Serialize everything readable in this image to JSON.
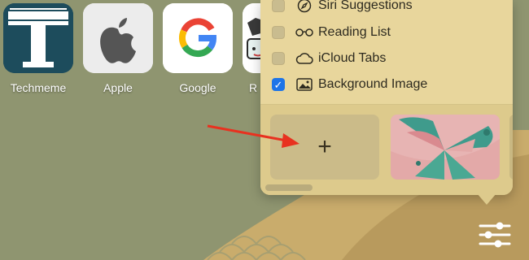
{
  "favorites": [
    {
      "label": "Techmeme",
      "icon": "techmeme-T-logo"
    },
    {
      "label": "Apple",
      "icon": "apple-logo"
    },
    {
      "label": "Google",
      "icon": "google-G-logo"
    },
    {
      "label": "R",
      "icon": "partial-favicon"
    }
  ],
  "customize_menu": {
    "options": [
      {
        "label": "Siri Suggestions",
        "checked": false,
        "icon": "compass-icon"
      },
      {
        "label": "Reading List",
        "checked": false,
        "icon": "glasses-icon"
      },
      {
        "label": "iCloud Tabs",
        "checked": false,
        "icon": "cloud-icon"
      },
      {
        "label": "Background Image",
        "checked": true,
        "icon": "image-icon"
      }
    ],
    "add_image_symbol": "+",
    "checkmark": "✓"
  },
  "colors": {
    "background": "#8f9570",
    "popover": "#e8d69c",
    "checkbox_checked": "#1d74e8",
    "annotation_arrow": "#e8311f"
  }
}
